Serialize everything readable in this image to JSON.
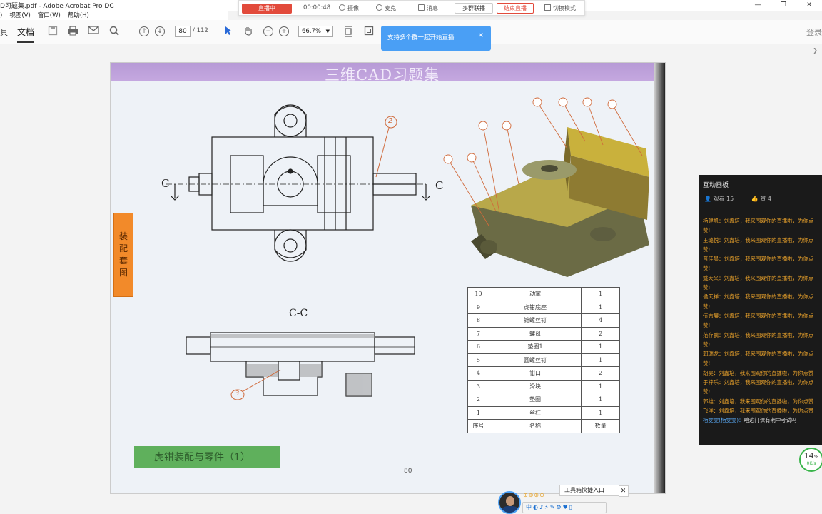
{
  "window": {
    "title": "D习题集.pdf - Adobe Acrobat Pro DC",
    "controls": [
      "—",
      "❐",
      "✕"
    ]
  },
  "menu": [
    ")",
    "视图(V)",
    "窗口(W)",
    "帮助(H)"
  ],
  "livebar": {
    "status": "直播中",
    "time": "00:00:48",
    "camera": "摄像",
    "mic": "麦克",
    "message": "消息",
    "multi": "多群联播",
    "end": "结束直播",
    "mode": "切换模式"
  },
  "toolbar": {
    "home": "具",
    "document": "文档",
    "page_current": "80",
    "page_total": "/ 112",
    "zoom": "66.7%",
    "login": "登录"
  },
  "tooltip": {
    "message": "支持多个群一起开始直播",
    "close": "×"
  },
  "page": {
    "title": "三维CAD习题集",
    "side_tab": "装配套图",
    "bottom_tab": "虎钳装配与零件（1）",
    "page_number": "80",
    "section_label": "C-C",
    "c_left": "C",
    "c_right": "C",
    "callout_2": "2",
    "callout_3": "3"
  },
  "parts_table": {
    "rows": [
      [
        "10",
        "动掌",
        "1"
      ],
      [
        "9",
        "虎钳底座",
        "1"
      ],
      [
        "8",
        "锥螺丝钉",
        "4"
      ],
      [
        "7",
        "螺母",
        "2"
      ],
      [
        "6",
        "垫圈1",
        "1"
      ],
      [
        "5",
        "圆螺丝钉",
        "1"
      ],
      [
        "4",
        "钳口",
        "2"
      ],
      [
        "3",
        "滑块",
        "1"
      ],
      [
        "2",
        "垫圈",
        "1"
      ],
      [
        "1",
        "丝杠",
        "1"
      ]
    ],
    "header": [
      "序号",
      "名称",
      "数量"
    ]
  },
  "chat": {
    "title": "互动画板",
    "viewers": "观看 15",
    "likes": "赞 4",
    "messages": [
      {
        "name": "杨建凯：",
        "text": "刘鑫培，我来围观你的直播啦，为你点"
      },
      {
        "name": "",
        "text": "赞!"
      },
      {
        "name": "王璐悦：",
        "text": "刘鑫培，我来围观你的直播啦，为你点"
      },
      {
        "name": "",
        "text": "赞!"
      },
      {
        "name": "晋佳晨：",
        "text": "刘鑫培，我来围观你的直播啦，为你点"
      },
      {
        "name": "",
        "text": "赞!"
      },
      {
        "name": "姚天义：",
        "text": "刘鑫培，我来围观你的直播啦，为你点"
      },
      {
        "name": "",
        "text": "赞!"
      },
      {
        "name": "侯天祥：",
        "text": "刘鑫培，我来围观你的直播啦，为你点"
      },
      {
        "name": "",
        "text": "赞!"
      },
      {
        "name": "伍志展：",
        "text": "刘鑫培，我来围观你的直播啦，为你点"
      },
      {
        "name": "",
        "text": "赞!"
      },
      {
        "name": "范存鹏：",
        "text": "刘鑫培，我来围观你的直播啦，为你点"
      },
      {
        "name": "",
        "text": "赞!"
      },
      {
        "name": "郭瑞龙：",
        "text": "刘鑫培，我来围观你的直播啦，为你点"
      },
      {
        "name": "",
        "text": "赞!"
      },
      {
        "name": "胡昊：",
        "text": "刘鑫培，我来围观你的直播啦，为你点赞"
      },
      {
        "name": "于梓乐：",
        "text": "刘鑫培，我来围观你的直播啦，为你点"
      },
      {
        "name": "",
        "text": "赞!"
      },
      {
        "name": "郭雄：",
        "text": "刘鑫培，我来围观你的直播啦，为你点赞"
      },
      {
        "name": "飞洋：",
        "text": "刘鑫培，我来围观你的直播啦，为你点赞"
      },
      {
        "name": "杨雯雯(杨雯雯)：",
        "text": "咱这门课有期中考试吗"
      }
    ]
  },
  "speed": {
    "percent": "14",
    "unit": "%",
    "rate": "0K/s"
  },
  "tools_entry": "工具箱快捷入口",
  "badges": "⊕⊕⊕⊕",
  "quick_icons": "中◐♪⚡✎⚙♥▯"
}
